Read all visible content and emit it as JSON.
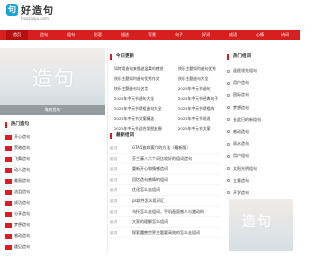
{
  "site": {
    "brand": "好造句",
    "domain": "haozaoju.com",
    "logo_char": "句"
  },
  "nav": [
    "首页",
    "造句",
    "组句",
    "形容",
    "描述",
    "写景",
    "句子",
    "好词",
    "成语",
    "心情",
    "诗词"
  ],
  "banner": {
    "char": "造句",
    "caption": "海底造句"
  },
  "hot": {
    "title": "热门造句",
    "items": [
      "开心造句",
      "黑暗造句",
      "飞舞造句",
      "动人造句",
      "美丽造句",
      "流泪造句",
      "成功造句",
      "分享造句",
      "梦想造句",
      "感动造句",
      "遇见造句"
    ]
  },
  "today": {
    "title": "今日更新",
    "left": [
      "如何用造句来描述温柔的感觉",
      "快乐主题如何造句优秀作文",
      "快乐主题造句与名言",
      "2025年中元节造句大全",
      "2025年中元节祭祖造句大全",
      "2025年中元节文案精选",
      "2025年中元节适合发朋友圈"
    ],
    "right": [
      "快乐主题如何造句优秀",
      "快乐主题造句大全",
      "2025年中元节造句",
      "2025年中元节经典句子",
      "2025年中元节祭祖的",
      "2025年中元节说说",
      "2025年中元节文案"
    ]
  },
  "latest": {
    "title": "最新组词",
    "items": [
      {
        "tag": "组词",
        "text": "GTA5放弃狐穴的方法（最新版）"
      },
      {
        "tag": "组词",
        "text": "芬兰藤八六个词比较好的组词造句"
      },
      {
        "tag": "组词",
        "text": "重新开心和情感造词"
      },
      {
        "tag": "组词",
        "text": "回忆造句感情的组词"
      },
      {
        "tag": "组词",
        "text": "优化怎么去组词"
      },
      {
        "tag": "组词",
        "text": "ps软件怎么组词汇"
      },
      {
        "tag": "组词",
        "text": "乌托怎么去组词，手机画面感人与激动的"
      },
      {
        "tag": "组词",
        "text": "大家的理解怎么组词"
      },
      {
        "tag": "组词",
        "text": "探索魔兽世界主题要高效的怎么去组词"
      }
    ]
  },
  "side": {
    "title": "热门组词",
    "items": [
      "遥遥领先组句",
      "用户造句",
      "国际造句",
      "梦想造句",
      "长此日的新组句",
      "感动造句",
      "雨水造句",
      "用户组句",
      "太阳光明组句",
      "立意造句",
      "开学造句"
    ]
  },
  "thumb": {
    "char": "造句"
  },
  "colors": {
    "brand_red": "#d71f1f",
    "logo_blue": "#19a4d8"
  }
}
